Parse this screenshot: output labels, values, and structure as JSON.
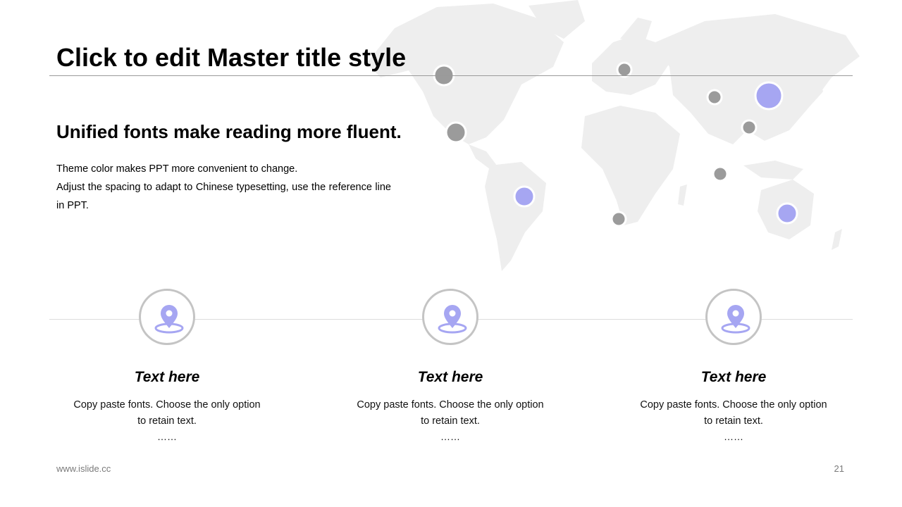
{
  "slide": {
    "title": "Click to edit Master title style",
    "subtitle": "Unified fonts make reading more fluent.",
    "body_lines": [
      "Theme color makes PPT more convenient to change.",
      "Adjust the spacing to adapt to Chinese typesetting, use the reference line in PPT."
    ]
  },
  "cards": [
    {
      "icon": "location-pin-icon",
      "title": "Text here",
      "text": "Copy paste fonts. Choose the only option to retain text.",
      "ellipsis": "……"
    },
    {
      "icon": "location-pin-icon",
      "title": "Text here",
      "text": "Copy paste fonts. Choose the only option to retain text.",
      "ellipsis": "……"
    },
    {
      "icon": "location-pin-icon",
      "title": "Text here",
      "text": "Copy paste fonts. Choose the only option to retain text.",
      "ellipsis": "……"
    }
  ],
  "footer": {
    "url": "www.islide.cc",
    "page_number": "21"
  },
  "colors": {
    "accent": "#a6a6f2",
    "marker_gray": "#9b9b9b",
    "map_fill": "#eeeeee",
    "circle_border": "#c4c4c4"
  }
}
